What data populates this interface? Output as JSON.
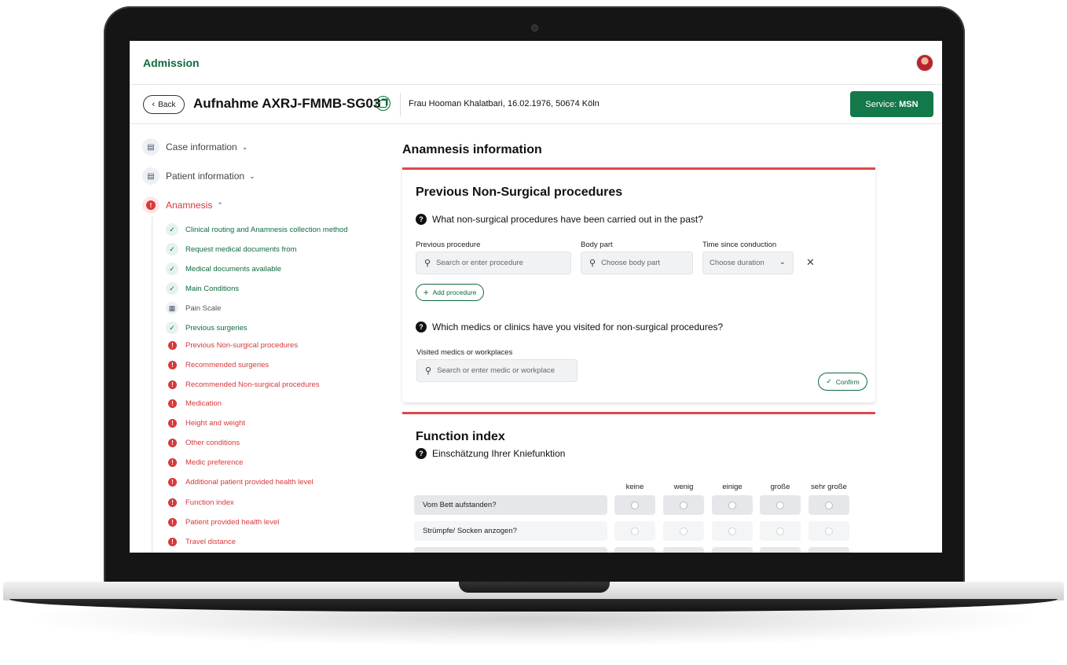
{
  "app": {
    "title": "Admission"
  },
  "case": {
    "back_label": "Back",
    "title": "Aufnahme AXRJ-FMMB-SG03",
    "patient": "Frau Hooman Khalatbari, 16.02.1976, 50674 Köln",
    "service_prefix": "Service:",
    "service_value": "MSN"
  },
  "sidebar": {
    "sections": [
      {
        "label": "Case information",
        "icon": "id-card-icon",
        "state": "collapsed"
      },
      {
        "label": "Patient information",
        "icon": "id-card-icon",
        "state": "collapsed"
      },
      {
        "label": "Anamnesis",
        "icon": "alert-icon",
        "state": "expanded"
      }
    ],
    "anamnesis_items": [
      {
        "label": "Clinical routing and Anamnesis collection method",
        "status": "done"
      },
      {
        "label": "Request medical documents from",
        "status": "done"
      },
      {
        "label": "Medical documents available",
        "status": "done"
      },
      {
        "label": "Main Conditions",
        "status": "done"
      },
      {
        "label": "Pain Scale",
        "status": "neutral"
      },
      {
        "label": "Previous surgeries",
        "status": "done"
      },
      {
        "label": "Previous Non-surgical procedures",
        "status": "error"
      },
      {
        "label": "Recommended surgeries",
        "status": "error"
      },
      {
        "label": "Recommended Non-surgical procedures",
        "status": "error"
      },
      {
        "label": "Medication",
        "status": "error"
      },
      {
        "label": "Height and weight",
        "status": "error"
      },
      {
        "label": "Other conditions",
        "status": "error"
      },
      {
        "label": "Medic preference",
        "status": "error"
      },
      {
        "label": "Additional patient provided health level",
        "status": "error"
      },
      {
        "label": "Function index",
        "status": "error"
      },
      {
        "label": "Patient provided health level",
        "status": "error"
      },
      {
        "label": "Travel distance",
        "status": "error"
      }
    ]
  },
  "main": {
    "heading": "Anamnesis information",
    "procedures_card": {
      "title": "Previous Non-Surgical procedures",
      "question1": "What non-surgical procedures have been carried out in the past?",
      "col_procedure": "Previous procedure",
      "col_body_part": "Body part",
      "col_time": "Time since conduction",
      "procedure_placeholder": "Search or enter procedure",
      "body_part_placeholder": "Choose body part",
      "duration_placeholder": "Choose duration",
      "add_label": "Add procedure",
      "question2": "Which medics or clinics have you visited for non-surgical procedures?",
      "medics_label": "Visited medics or workplaces",
      "medics_placeholder": "Search or enter medic or workplace",
      "confirm_label": "Confirm"
    },
    "function_card": {
      "title": "Function index",
      "question": "Einschätzung Ihrer Kniefunktion",
      "columns": [
        "keine",
        "wenig",
        "einige",
        "große",
        "sehr große"
      ],
      "rows": [
        "Vom Bett aufstanden?",
        "Strümpfe/ Socken anzogen?"
      ]
    }
  },
  "colors": {
    "brand_green": "#0f6b3e",
    "button_green": "#13784a",
    "error_red": "#d8393a",
    "card_accent": "#e0474a"
  }
}
